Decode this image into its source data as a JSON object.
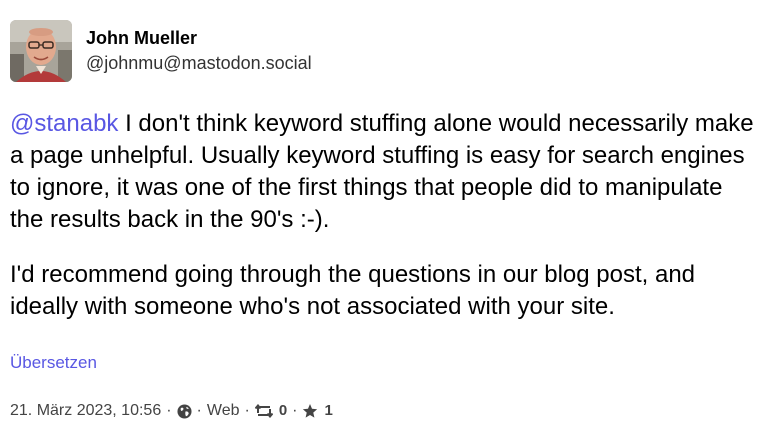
{
  "author": {
    "display_name": "John Mueller",
    "handle": "@johnmu@mastodon.social"
  },
  "post": {
    "mention": "@stanabk",
    "paragraph1_rest": " I don't think keyword stuffing alone would necessarily make a page unhelpful. Usually keyword stuffing is easy for search engines to ignore, it was one of the first things that people did to manipulate the results back in the 90's :-).",
    "paragraph2": "I'd recommend going through the questions in our blog post, and ideally with someone who's not associated with your site.",
    "translate_label": "Übersetzen"
  },
  "meta": {
    "timestamp": "21. März 2023, 10:56",
    "separator": "·",
    "visibility_icon": "globe-icon",
    "client": "Web",
    "boost_icon": "boost-icon",
    "boosts": "0",
    "favourite_icon": "star-icon",
    "favourites": "1"
  },
  "colors": {
    "link": "#5957e3",
    "meta_text": "#444444",
    "text": "#000000"
  }
}
